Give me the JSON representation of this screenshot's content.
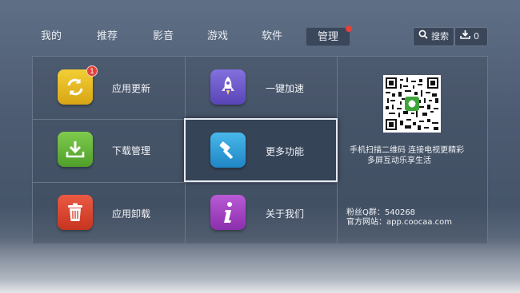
{
  "nav": {
    "tabs": [
      {
        "label": "我的"
      },
      {
        "label": "推荐"
      },
      {
        "label": "影音"
      },
      {
        "label": "游戏"
      },
      {
        "label": "软件"
      },
      {
        "label": "管理",
        "active": true,
        "has_dot": true
      }
    ],
    "search_label": "搜索",
    "download_count": "0"
  },
  "apps": [
    {
      "label": "应用更新",
      "icon": "refresh-icon",
      "color": "#e2b81c",
      "badge": "1"
    },
    {
      "label": "一键加速",
      "icon": "rocket-icon",
      "color": "#6c58c9"
    },
    {
      "label": "下载管理",
      "icon": "download-icon",
      "color": "#62b63a"
    },
    {
      "label": "更多功能",
      "icon": "hammer-icon",
      "color": "#2f9fd8",
      "selected": true
    },
    {
      "label": "应用卸载",
      "icon": "trash-icon",
      "color": "#d9442f"
    },
    {
      "label": "关于我们",
      "icon": "info-icon",
      "color": "#9f3fbf"
    }
  ],
  "info_panel": {
    "qr_caption_line1": "手机扫描二维码 连接电视更精彩",
    "qr_caption_line2": "多屏互动乐享生活",
    "fans_group": "粉丝Q群：540268",
    "official_site": "官方网站：app.coocaa.com"
  }
}
